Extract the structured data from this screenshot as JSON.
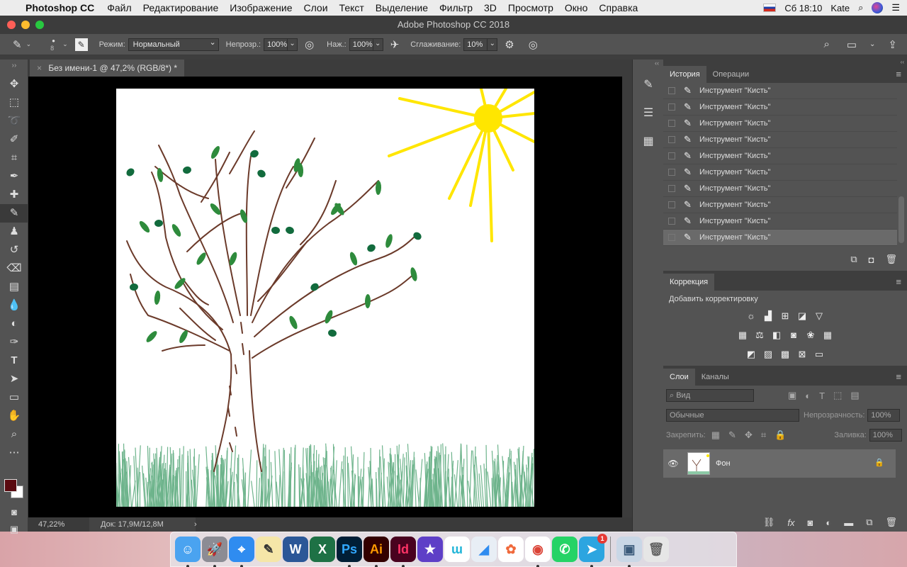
{
  "menubar": {
    "app": "Photoshop CC",
    "items": [
      "Файл",
      "Редактирование",
      "Изображение",
      "Слои",
      "Текст",
      "Выделение",
      "Фильтр",
      "3D",
      "Просмотр",
      "Окно",
      "Справка"
    ],
    "clock": "Сб 18:10",
    "user": "Kate"
  },
  "window": {
    "title": "Adobe Photoshop CC 2018"
  },
  "options_bar": {
    "brush_size": "8",
    "mode_label": "Режим:",
    "mode_value": "Нормальный",
    "opacity_label": "Непрозр.:",
    "opacity_value": "100%",
    "pressure_label": "Наж.:",
    "pressure_value": "100%",
    "smoothing_label": "Сглаживание:",
    "smoothing_value": "10%"
  },
  "document": {
    "tab_title": "Без имени-1 @ 47,2% (RGB/8*) *",
    "zoom": "47,22%",
    "doc_info": "Док: 17,9M/12,8M"
  },
  "history_panel": {
    "tabs": [
      "История",
      "Операции"
    ],
    "items": [
      "Инструмент \"Кисть\"",
      "Инструмент \"Кисть\"",
      "Инструмент \"Кисть\"",
      "Инструмент \"Кисть\"",
      "Инструмент \"Кисть\"",
      "Инструмент \"Кисть\"",
      "Инструмент \"Кисть\"",
      "Инструмент \"Кисть\"",
      "Инструмент \"Кисть\"",
      "Инструмент \"Кисть\""
    ]
  },
  "adjustments_panel": {
    "tab": "Коррекция",
    "title": "Добавить корректировку"
  },
  "layers_panel": {
    "tabs": [
      "Слои",
      "Каналы"
    ],
    "filter_placeholder": "Вид",
    "blend_mode": "Обычные",
    "opacity_label": "Непрозрачность:",
    "opacity_value": "100%",
    "lock_label": "Закрепить:",
    "fill_label": "Заливка:",
    "fill_value": "100%",
    "layer_name": "Фон"
  },
  "colors": {
    "foreground": "#5a0a10",
    "background": "#ffffff",
    "accent_sun": "#ffe600",
    "tree_trunk": "#6b3a2a",
    "leaves": "#1d7a3a"
  },
  "dock": {
    "apps": [
      {
        "name": "Finder",
        "glyph": "☺",
        "bg": "#4aa3f0",
        "fg": "#fff"
      },
      {
        "name": "Launchpad",
        "glyph": "🚀",
        "bg": "#8c8c94",
        "fg": "#fff"
      },
      {
        "name": "Safari",
        "glyph": "⌖",
        "bg": "#2f8cf0",
        "fg": "#fff"
      },
      {
        "name": "Notes",
        "glyph": "✎",
        "bg": "#f5e6a8",
        "fg": "#333"
      },
      {
        "name": "Word",
        "glyph": "W",
        "bg": "#2b5797",
        "fg": "#fff"
      },
      {
        "name": "Excel",
        "glyph": "X",
        "bg": "#1e7145",
        "fg": "#fff"
      },
      {
        "name": "Photoshop",
        "glyph": "Ps",
        "bg": "#001e36",
        "fg": "#31a8ff"
      },
      {
        "name": "Illustrator",
        "glyph": "Ai",
        "bg": "#330000",
        "fg": "#ff9a00"
      },
      {
        "name": "InDesign",
        "glyph": "Id",
        "bg": "#49021f",
        "fg": "#ff3366"
      },
      {
        "name": "iMovie",
        "glyph": "★",
        "bg": "#5e3fc7",
        "fg": "#fff"
      },
      {
        "name": "Wrike",
        "glyph": "ɯ",
        "bg": "#ffffff",
        "fg": "#22b5d8"
      },
      {
        "name": "Dictionary",
        "glyph": "◢",
        "bg": "#e8eef5",
        "fg": "#2f8cf0"
      },
      {
        "name": "Photos",
        "glyph": "✿",
        "bg": "#ffffff",
        "fg": "#f06a3c"
      },
      {
        "name": "Chrome",
        "glyph": "◉",
        "bg": "#ffffff",
        "fg": "#db4437"
      },
      {
        "name": "WhatsApp",
        "glyph": "✆",
        "bg": "#25d366",
        "fg": "#fff"
      },
      {
        "name": "Telegram",
        "glyph": "➤",
        "bg": "#2ca5e0",
        "fg": "#fff",
        "badge": "1"
      },
      {
        "name": "Preview",
        "glyph": "▣",
        "bg": "#c9d7e6",
        "fg": "#3a5a7a"
      },
      {
        "name": "Trash",
        "glyph": "🗑",
        "bg": "#e6e6e6",
        "fg": "#666"
      }
    ]
  }
}
